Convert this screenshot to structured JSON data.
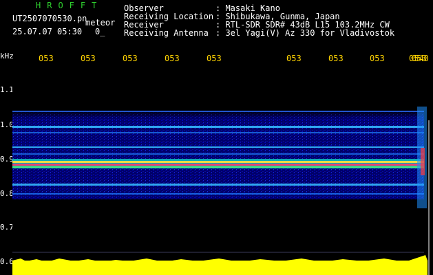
{
  "header": {
    "brand": "HROFFT",
    "filename": "UT2507070530.pn",
    "tag": "meteor",
    "datetime": "25.07.07 05:30",
    "short": "0_",
    "observer_label": "Observer",
    "observer_value": ": Masaki Kano",
    "location_label": "Receiving Location",
    "location_value": ": Shibukawa, Gunma, Japan",
    "receiver_label": "Receiver",
    "receiver_value": ": RTL-SDR SDR# 43dB L15 103.2MHz CW",
    "antenna_label": "Receiving Antenna",
    "antenna_value": ": 3el Yagi(V) Az 330 for Vladivostok"
  },
  "axis": {
    "unit": "kHz",
    "y_ticks": [
      "1.1",
      "1.0",
      "0.9",
      "0.8",
      "0.7",
      "0.6"
    ],
    "time_ticks": [
      "053",
      "053",
      "053",
      "053",
      "053",
      "053",
      "053",
      "053",
      "053",
      "0540"
    ]
  },
  "colors": {
    "background": "#000000",
    "header_text": "#ffffff",
    "brand": "#2ed02e",
    "time_ticks": "#ffd400",
    "noise_bar": "#ffff00"
  }
}
